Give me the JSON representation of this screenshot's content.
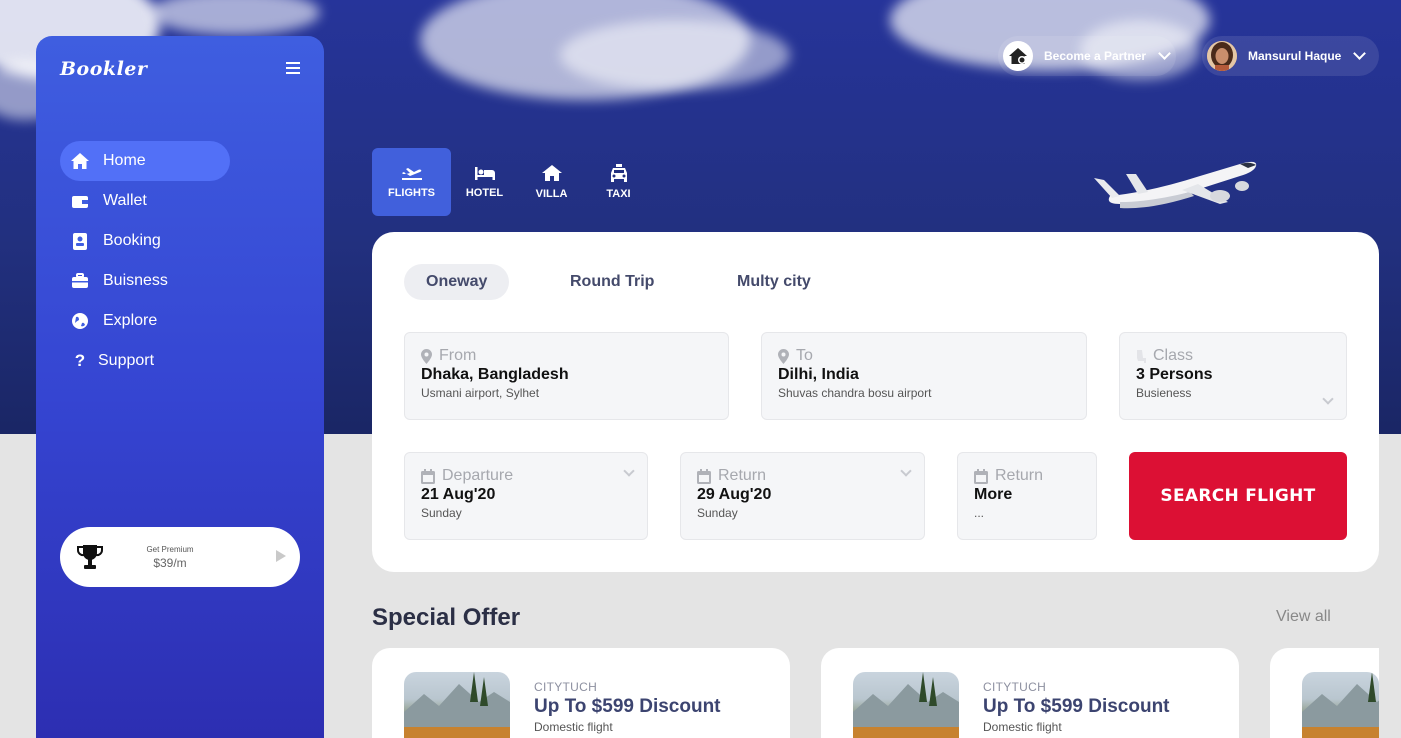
{
  "app": {
    "logo": "Bookler"
  },
  "sidebar": {
    "items": [
      {
        "label": "Home",
        "icon": "home-icon",
        "active": true
      },
      {
        "label": "Wallet",
        "icon": "wallet-icon"
      },
      {
        "label": "Booking",
        "icon": "booking-icon"
      },
      {
        "label": "Buisness",
        "icon": "briefcase-icon"
      },
      {
        "label": "Explore",
        "icon": "globe-icon"
      },
      {
        "label": "Support",
        "icon": "question-icon"
      }
    ],
    "premium": {
      "label": "Get Premium",
      "price": "$39/m"
    }
  },
  "header": {
    "partner_label": "Become a Partner",
    "user_name": "Mansurul Haque"
  },
  "tabs": [
    {
      "label": "FLIGHTS",
      "icon": "plane-icon",
      "active": true
    },
    {
      "label": "HOTEL",
      "icon": "bed-icon"
    },
    {
      "label": "VILLA",
      "icon": "house-icon"
    },
    {
      "label": "TAXI",
      "icon": "taxi-icon"
    }
  ],
  "search": {
    "trip_types": [
      "Oneway",
      "Round Trip",
      "Multy city"
    ],
    "active_trip": "Oneway",
    "from": {
      "label": "From",
      "value": "Dhaka, Bangladesh",
      "sub": "Usmani airport, Sylhet"
    },
    "to": {
      "label": "To",
      "value": "Dilhi, India",
      "sub": "Shuvas chandra bosu airport"
    },
    "class": {
      "label": "Class",
      "value": "3 Persons",
      "sub": "Busieness"
    },
    "departure": {
      "label": "Departure",
      "value": "21 Aug'20",
      "sub": "Sunday"
    },
    "return": {
      "label": "Return",
      "value": "29 Aug'20",
      "sub": "Sunday"
    },
    "more": {
      "label": "Return",
      "value": "More",
      "sub": "..."
    },
    "button": "SEARCH FLIGHT"
  },
  "offers": {
    "title": "Special Offer",
    "view_all": "View all",
    "items": [
      {
        "brand": "CITYTUCH",
        "headline": "Up To $599 Discount",
        "sub": "Domestic flight"
      },
      {
        "brand": "CITYTUCH",
        "headline": "Up To $599 Discount",
        "sub": "Domestic flight"
      }
    ]
  },
  "colors": {
    "primary": "#3f5ee0",
    "accent": "#dc1034",
    "hero": "#26349a"
  }
}
